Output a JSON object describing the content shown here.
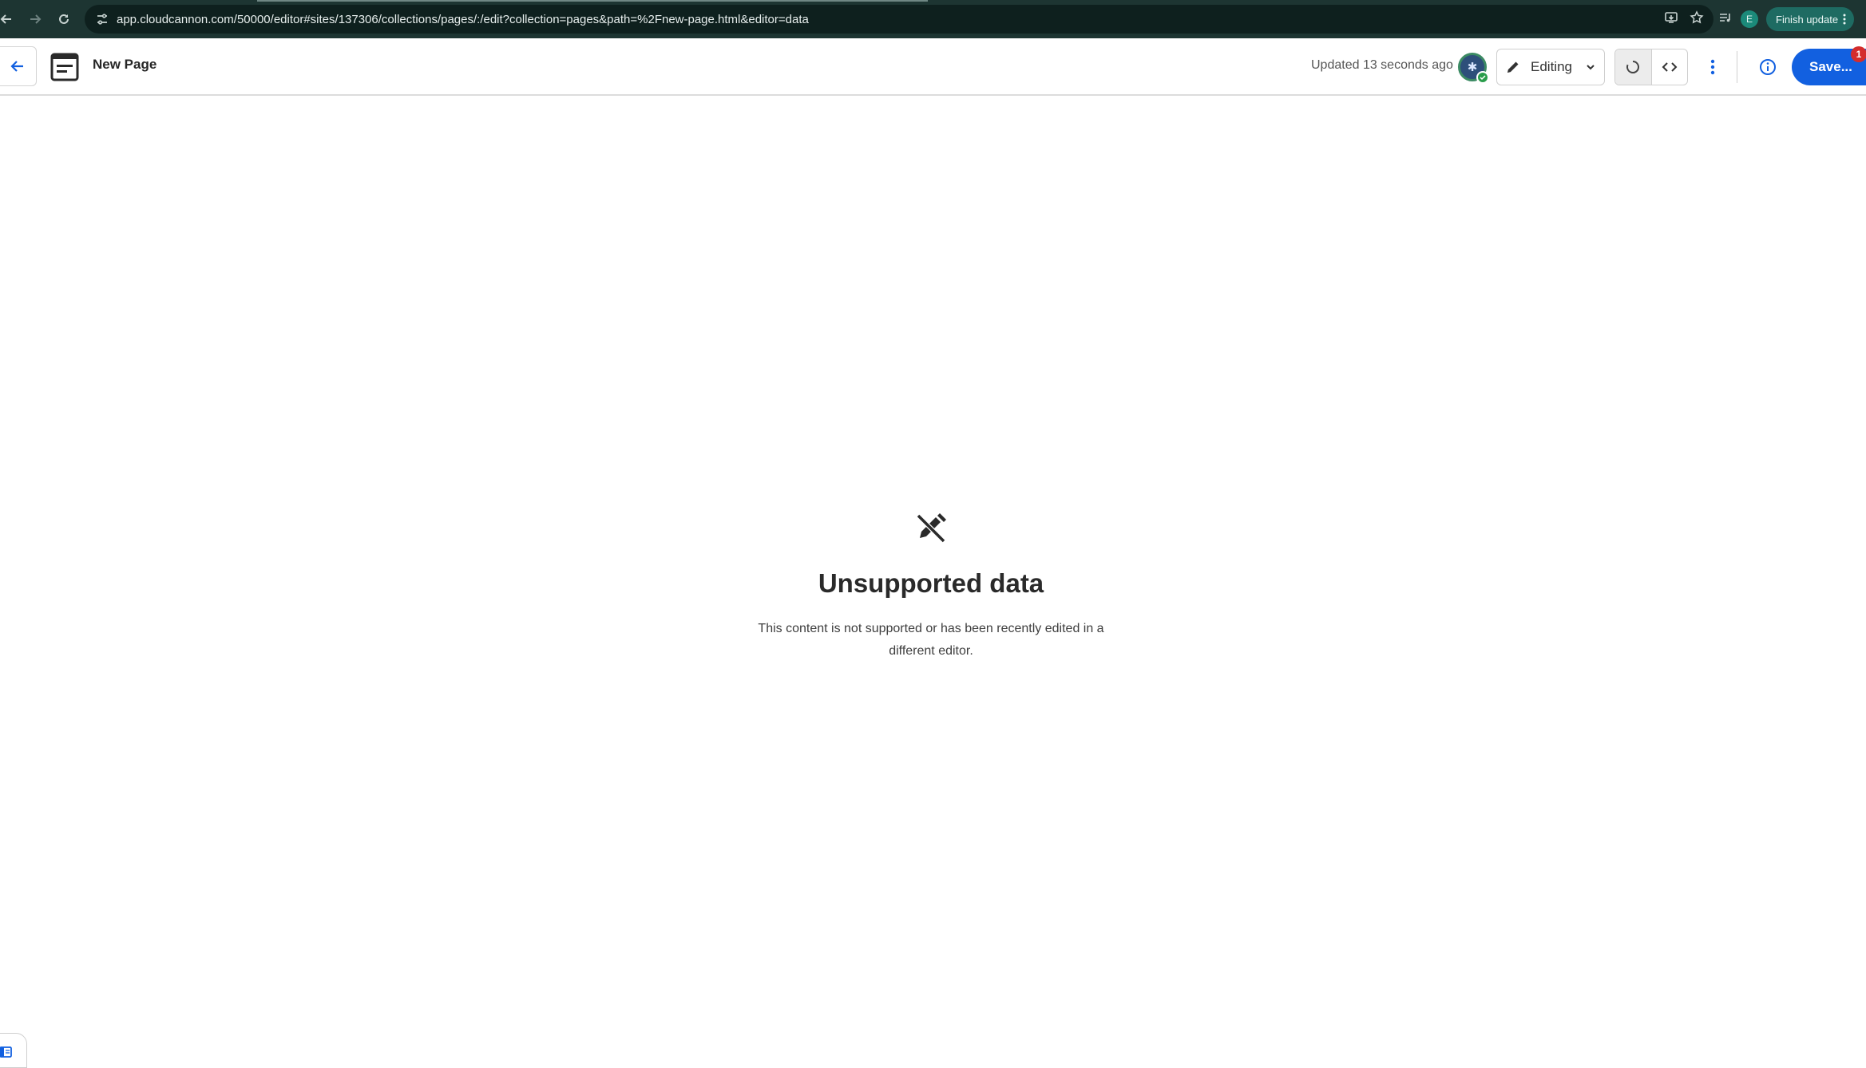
{
  "browser": {
    "url": "app.cloudcannon.com/50000/editor#sites/137306/collections/pages/:/edit?collection=pages&path=%2Fnew-page.html&editor=data",
    "profile_initial": "E",
    "finish_update_label": "Finish update",
    "icons": [
      "arrow-left-icon",
      "arrow-right-icon",
      "reload-icon",
      "tune-icon",
      "install-icon",
      "star-icon",
      "media-icon",
      "kebab-icon"
    ]
  },
  "header": {
    "page_title": "New Page",
    "updated_text": "Updated 13 seconds ago",
    "avatar_glyph": "✱",
    "editing_label": "Editing",
    "save_label": "Save...",
    "save_badge_count": "1",
    "accent_color": "#1260e0"
  },
  "main": {
    "empty_title": "Unsupported data",
    "empty_description": "This content is not supported or has been recently edited in a different editor."
  }
}
